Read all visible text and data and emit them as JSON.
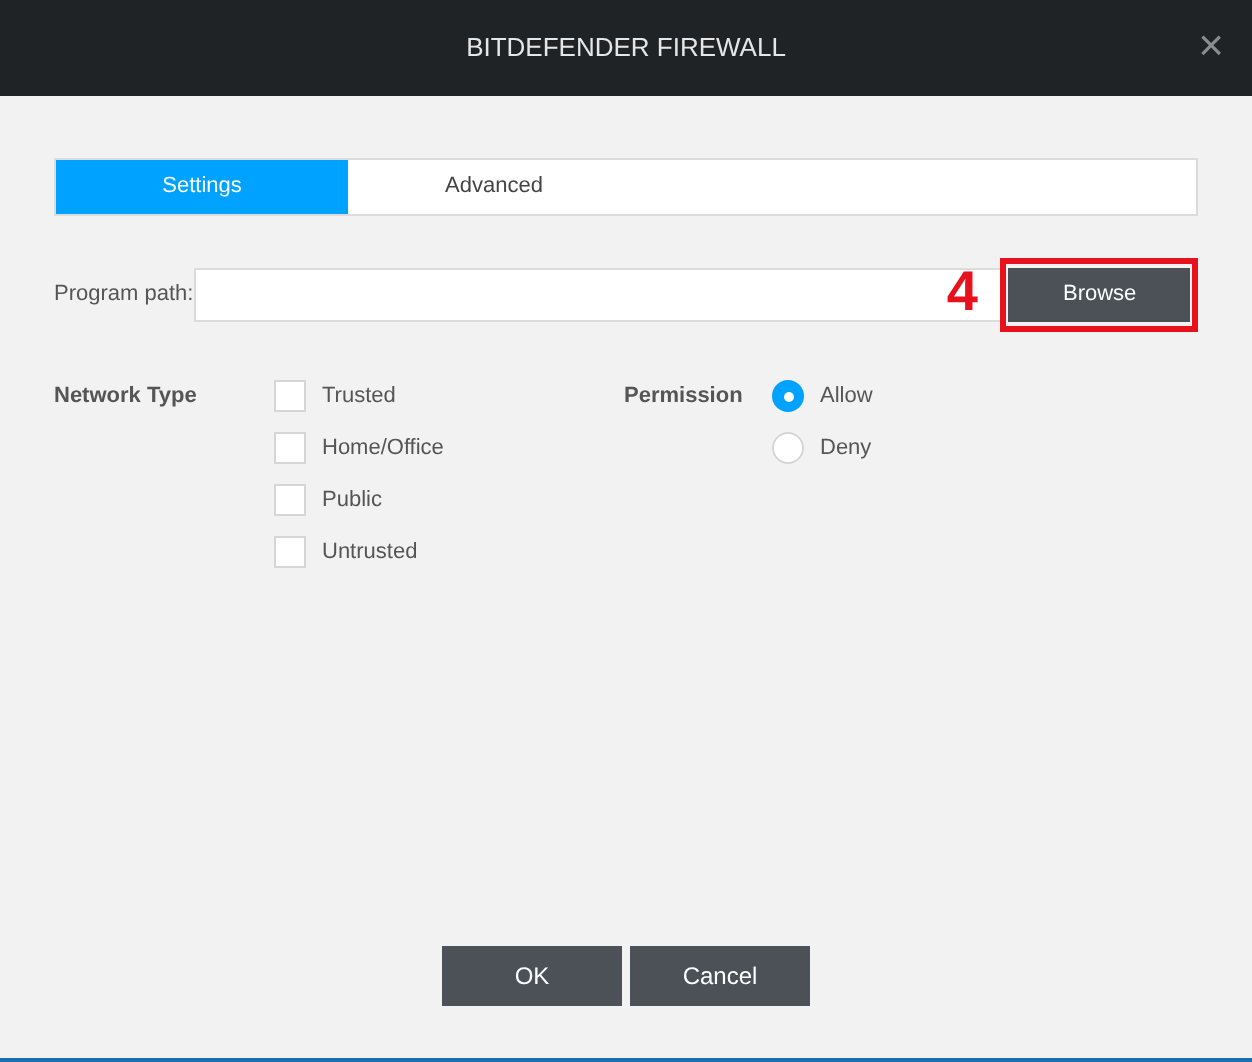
{
  "window": {
    "title": "BITDEFENDER FIREWALL",
    "close": "×"
  },
  "tabs": [
    {
      "label": "Settings",
      "selected": true
    },
    {
      "label": "Advanced",
      "selected": false
    }
  ],
  "program_path": {
    "label": "Program path:",
    "button": "Browse",
    "annotation": "4"
  },
  "network_type": {
    "label": "Network Type",
    "options": [
      {
        "label": "Trusted",
        "checked": false
      },
      {
        "label": "Home/Office",
        "checked": false
      },
      {
        "label": "Public",
        "checked": false
      },
      {
        "label": "Untrusted",
        "checked": false
      }
    ]
  },
  "permission": {
    "label": "Permission",
    "options": [
      {
        "label": "Allow",
        "selected": true
      },
      {
        "label": "Deny",
        "selected": false
      }
    ]
  },
  "buttons": [
    "OK",
    "Cancel"
  ]
}
